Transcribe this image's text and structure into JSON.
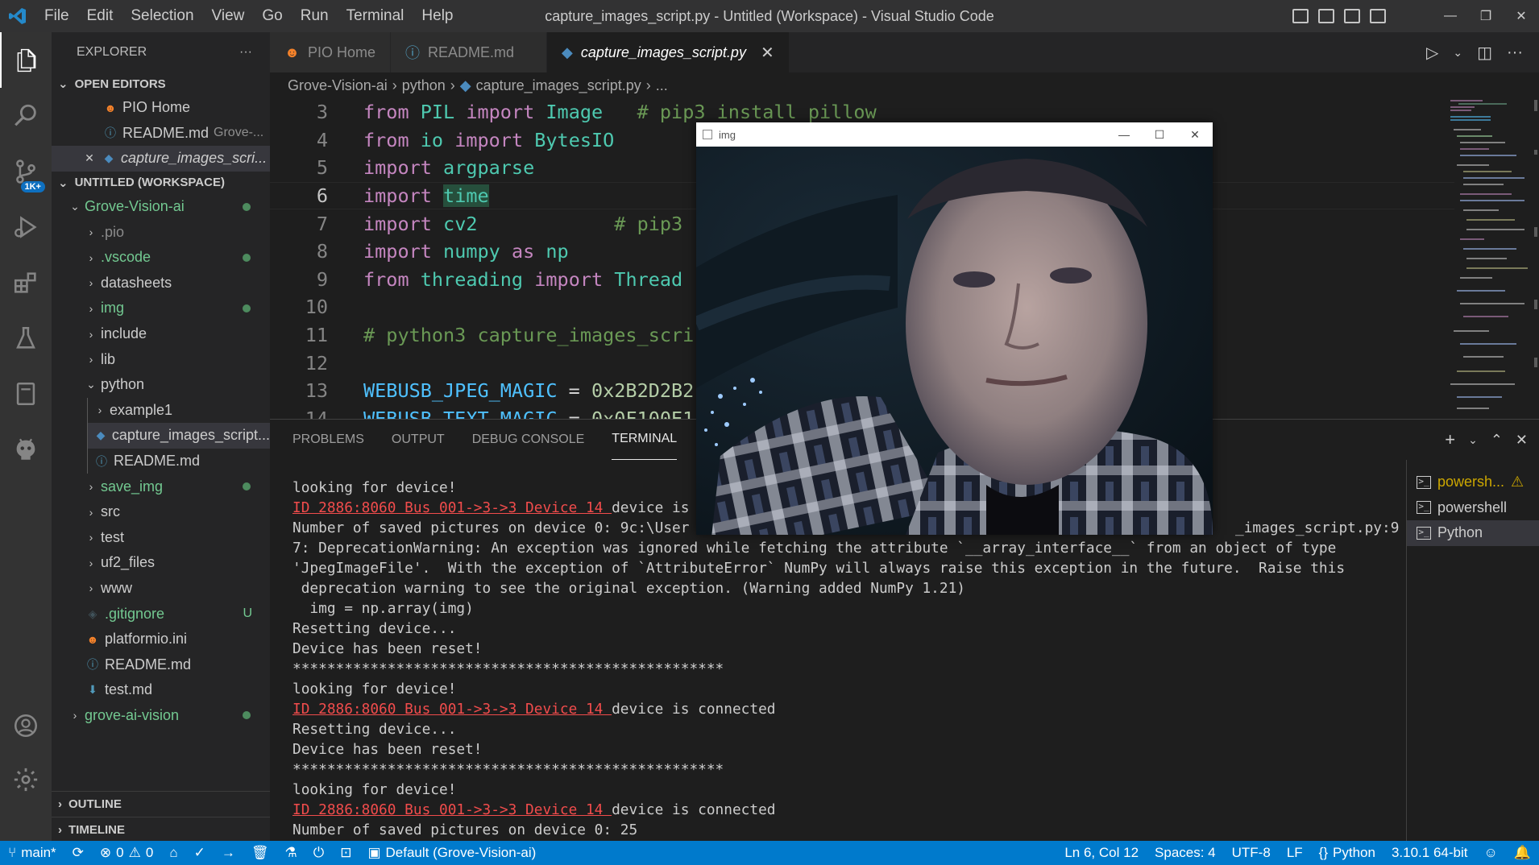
{
  "titlebar": {
    "menu": [
      "File",
      "Edit",
      "Selection",
      "View",
      "Go",
      "Run",
      "Terminal",
      "Help"
    ],
    "title": "capture_images_script.py - Untitled (Workspace) - Visual Studio Code"
  },
  "activity": {
    "badge": "1K+"
  },
  "sidebar": {
    "header": "EXPLORER",
    "more": "···",
    "open_editors": {
      "title": "OPEN EDITORS",
      "items": [
        {
          "label": "PIO Home",
          "desc": ""
        },
        {
          "label": "README.md",
          "desc": "Grove-..."
        },
        {
          "label": "capture_images_scri...",
          "desc": ""
        }
      ]
    },
    "workspace": {
      "title": "UNTITLED (WORKSPACE)",
      "items": [
        {
          "label": "Grove-Vision-ai"
        },
        {
          "label": ".pio"
        },
        {
          "label": ".vscode"
        },
        {
          "label": "datasheets"
        },
        {
          "label": "img"
        },
        {
          "label": "include"
        },
        {
          "label": "lib"
        },
        {
          "label": "python"
        },
        {
          "label": "example1"
        },
        {
          "label": "capture_images_script..."
        },
        {
          "label": "README.md"
        },
        {
          "label": "save_img"
        },
        {
          "label": "src"
        },
        {
          "label": "test"
        },
        {
          "label": "uf2_files"
        },
        {
          "label": "www"
        },
        {
          "label": ".gitignore",
          "badge": "U"
        },
        {
          "label": "platformio.ini"
        },
        {
          "label": "README.md"
        },
        {
          "label": "test.md"
        },
        {
          "label": "grove-ai-vision"
        }
      ]
    },
    "outline": "OUTLINE",
    "timeline": "TIMELINE"
  },
  "editor": {
    "tabs": [
      {
        "label": "PIO Home"
      },
      {
        "label": "README.md"
      },
      {
        "label": "capture_images_script.py",
        "close": "✕"
      }
    ],
    "breadcrumb": [
      "Grove-Vision-ai",
      "python",
      "capture_images_script.py",
      "..."
    ],
    "line_numbers": [
      "3",
      "4",
      "5",
      "6",
      "7",
      "8",
      "9",
      "10",
      "11",
      "12",
      "13",
      "14"
    ],
    "code": {
      "l3": [
        "from",
        " ",
        "PIL",
        " ",
        "import",
        " ",
        "Image",
        "   ",
        "# pip3 install pillow"
      ],
      "l4": [
        "from",
        " ",
        "io",
        " ",
        "import",
        " ",
        "BytesIO"
      ],
      "l5": [
        "import",
        " ",
        "argparse"
      ],
      "l6": [
        "import",
        " ",
        "time"
      ],
      "l7": [
        "import",
        " ",
        "cv2",
        "            ",
        "# pip3"
      ],
      "l8": [
        "import",
        " ",
        "numpy",
        " ",
        "as",
        " ",
        "np"
      ],
      "l9": [
        "from",
        " ",
        "threading",
        " ",
        "import",
        " ",
        "Thread"
      ],
      "l11": "# python3 capture_images_scri",
      "l13": [
        "WEBUSB_JPEG_MAGIC",
        " = ",
        "0x2B2D2B2"
      ],
      "l14": [
        "WEBUSB_TEXT_MAGIC",
        " = ",
        "0x0F100E1"
      ]
    }
  },
  "panel": {
    "tabs": [
      "PROBLEMS",
      "OUTPUT",
      "DEBUG CONSOLE",
      "TERMINAL"
    ],
    "terminal_lines": [
      {
        "text": "looking for device!"
      },
      {
        "red": "ID 2886:8060 Bus 001->3->3 Device 14 ",
        "text": "device is"
      },
      {
        "text": "Number of saved pictures on device 0: 9c:\\User",
        "tail": "_images_script.py:9"
      },
      {
        "text": "7: DeprecationWarning: An exception was ignored while fetching the attribute `__array_interface__` from an object of type"
      },
      {
        "text": "'JpegImageFile'.  With the exception of `AttributeError` NumPy will always raise this exception in the future.  Raise this"
      },
      {
        "text": " deprecation warning to see the original exception. (Warning added NumPy 1.21)"
      },
      {
        "text": "  img = np.array(img)"
      },
      {
        "text": "Resetting device..."
      },
      {
        "text": "Device has been reset!"
      },
      {
        "text": "**************************************************"
      },
      {
        "text": "looking for device!"
      },
      {
        "red": "ID 2886:8060 Bus 001->3->3 Device 14 ",
        "text": "device is connected"
      },
      {
        "text": "Resetting device..."
      },
      {
        "text": "Device has been reset!"
      },
      {
        "text": "**************************************************"
      },
      {
        "text": "looking for device!"
      },
      {
        "red": "ID 2886:8060 Bus 001->3->3 Device 14 ",
        "text": "device is connected"
      },
      {
        "text": "Number of saved pictures on device 0: 25"
      }
    ],
    "terminals": [
      {
        "label": "powersh...",
        "warn": "⚠"
      },
      {
        "label": "powershell"
      },
      {
        "label": "Python"
      }
    ]
  },
  "img_window": {
    "title": "img"
  },
  "statusbar": {
    "branch": "main*",
    "errors": "0",
    "warnings": "0",
    "pio_env": "Default (Grove-Vision-ai)",
    "position": "Ln 6, Col 12",
    "spaces": "Spaces: 4",
    "encoding": "UTF-8",
    "eol": "LF",
    "language": "Python",
    "interpreter": "3.10.1 64-bit"
  },
  "colors": {
    "accent": "#007acc",
    "keyword": "#c586c0",
    "module": "#4ec9b0",
    "comment": "#6a9955",
    "constant": "#4fc1ff",
    "number": "#b5cea8",
    "git_added": "#73c991",
    "error": "#f14c4c"
  }
}
